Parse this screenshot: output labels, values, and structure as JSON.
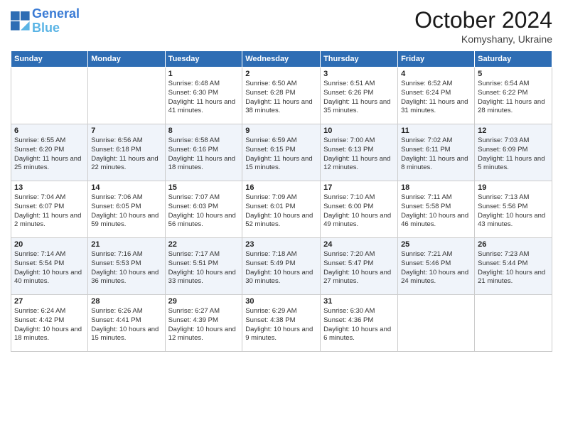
{
  "logo": {
    "line1": "General",
    "line2": "Blue"
  },
  "header": {
    "month": "October 2024",
    "location": "Komyshany, Ukraine"
  },
  "weekdays": [
    "Sunday",
    "Monday",
    "Tuesday",
    "Wednesday",
    "Thursday",
    "Friday",
    "Saturday"
  ],
  "weeks": [
    [
      {
        "day": "",
        "sunrise": "",
        "sunset": "",
        "daylight": ""
      },
      {
        "day": "",
        "sunrise": "",
        "sunset": "",
        "daylight": ""
      },
      {
        "day": "1",
        "sunrise": "Sunrise: 6:48 AM",
        "sunset": "Sunset: 6:30 PM",
        "daylight": "Daylight: 11 hours and 41 minutes."
      },
      {
        "day": "2",
        "sunrise": "Sunrise: 6:50 AM",
        "sunset": "Sunset: 6:28 PM",
        "daylight": "Daylight: 11 hours and 38 minutes."
      },
      {
        "day": "3",
        "sunrise": "Sunrise: 6:51 AM",
        "sunset": "Sunset: 6:26 PM",
        "daylight": "Daylight: 11 hours and 35 minutes."
      },
      {
        "day": "4",
        "sunrise": "Sunrise: 6:52 AM",
        "sunset": "Sunset: 6:24 PM",
        "daylight": "Daylight: 11 hours and 31 minutes."
      },
      {
        "day": "5",
        "sunrise": "Sunrise: 6:54 AM",
        "sunset": "Sunset: 6:22 PM",
        "daylight": "Daylight: 11 hours and 28 minutes."
      }
    ],
    [
      {
        "day": "6",
        "sunrise": "Sunrise: 6:55 AM",
        "sunset": "Sunset: 6:20 PM",
        "daylight": "Daylight: 11 hours and 25 minutes."
      },
      {
        "day": "7",
        "sunrise": "Sunrise: 6:56 AM",
        "sunset": "Sunset: 6:18 PM",
        "daylight": "Daylight: 11 hours and 22 minutes."
      },
      {
        "day": "8",
        "sunrise": "Sunrise: 6:58 AM",
        "sunset": "Sunset: 6:16 PM",
        "daylight": "Daylight: 11 hours and 18 minutes."
      },
      {
        "day": "9",
        "sunrise": "Sunrise: 6:59 AM",
        "sunset": "Sunset: 6:15 PM",
        "daylight": "Daylight: 11 hours and 15 minutes."
      },
      {
        "day": "10",
        "sunrise": "Sunrise: 7:00 AM",
        "sunset": "Sunset: 6:13 PM",
        "daylight": "Daylight: 11 hours and 12 minutes."
      },
      {
        "day": "11",
        "sunrise": "Sunrise: 7:02 AM",
        "sunset": "Sunset: 6:11 PM",
        "daylight": "Daylight: 11 hours and 8 minutes."
      },
      {
        "day": "12",
        "sunrise": "Sunrise: 7:03 AM",
        "sunset": "Sunset: 6:09 PM",
        "daylight": "Daylight: 11 hours and 5 minutes."
      }
    ],
    [
      {
        "day": "13",
        "sunrise": "Sunrise: 7:04 AM",
        "sunset": "Sunset: 6:07 PM",
        "daylight": "Daylight: 11 hours and 2 minutes."
      },
      {
        "day": "14",
        "sunrise": "Sunrise: 7:06 AM",
        "sunset": "Sunset: 6:05 PM",
        "daylight": "Daylight: 10 hours and 59 minutes."
      },
      {
        "day": "15",
        "sunrise": "Sunrise: 7:07 AM",
        "sunset": "Sunset: 6:03 PM",
        "daylight": "Daylight: 10 hours and 56 minutes."
      },
      {
        "day": "16",
        "sunrise": "Sunrise: 7:09 AM",
        "sunset": "Sunset: 6:01 PM",
        "daylight": "Daylight: 10 hours and 52 minutes."
      },
      {
        "day": "17",
        "sunrise": "Sunrise: 7:10 AM",
        "sunset": "Sunset: 6:00 PM",
        "daylight": "Daylight: 10 hours and 49 minutes."
      },
      {
        "day": "18",
        "sunrise": "Sunrise: 7:11 AM",
        "sunset": "Sunset: 5:58 PM",
        "daylight": "Daylight: 10 hours and 46 minutes."
      },
      {
        "day": "19",
        "sunrise": "Sunrise: 7:13 AM",
        "sunset": "Sunset: 5:56 PM",
        "daylight": "Daylight: 10 hours and 43 minutes."
      }
    ],
    [
      {
        "day": "20",
        "sunrise": "Sunrise: 7:14 AM",
        "sunset": "Sunset: 5:54 PM",
        "daylight": "Daylight: 10 hours and 40 minutes."
      },
      {
        "day": "21",
        "sunrise": "Sunrise: 7:16 AM",
        "sunset": "Sunset: 5:53 PM",
        "daylight": "Daylight: 10 hours and 36 minutes."
      },
      {
        "day": "22",
        "sunrise": "Sunrise: 7:17 AM",
        "sunset": "Sunset: 5:51 PM",
        "daylight": "Daylight: 10 hours and 33 minutes."
      },
      {
        "day": "23",
        "sunrise": "Sunrise: 7:18 AM",
        "sunset": "Sunset: 5:49 PM",
        "daylight": "Daylight: 10 hours and 30 minutes."
      },
      {
        "day": "24",
        "sunrise": "Sunrise: 7:20 AM",
        "sunset": "Sunset: 5:47 PM",
        "daylight": "Daylight: 10 hours and 27 minutes."
      },
      {
        "day": "25",
        "sunrise": "Sunrise: 7:21 AM",
        "sunset": "Sunset: 5:46 PM",
        "daylight": "Daylight: 10 hours and 24 minutes."
      },
      {
        "day": "26",
        "sunrise": "Sunrise: 7:23 AM",
        "sunset": "Sunset: 5:44 PM",
        "daylight": "Daylight: 10 hours and 21 minutes."
      }
    ],
    [
      {
        "day": "27",
        "sunrise": "Sunrise: 6:24 AM",
        "sunset": "Sunset: 4:42 PM",
        "daylight": "Daylight: 10 hours and 18 minutes."
      },
      {
        "day": "28",
        "sunrise": "Sunrise: 6:26 AM",
        "sunset": "Sunset: 4:41 PM",
        "daylight": "Daylight: 10 hours and 15 minutes."
      },
      {
        "day": "29",
        "sunrise": "Sunrise: 6:27 AM",
        "sunset": "Sunset: 4:39 PM",
        "daylight": "Daylight: 10 hours and 12 minutes."
      },
      {
        "day": "30",
        "sunrise": "Sunrise: 6:29 AM",
        "sunset": "Sunset: 4:38 PM",
        "daylight": "Daylight: 10 hours and 9 minutes."
      },
      {
        "day": "31",
        "sunrise": "Sunrise: 6:30 AM",
        "sunset": "Sunset: 4:36 PM",
        "daylight": "Daylight: 10 hours and 6 minutes."
      },
      {
        "day": "",
        "sunrise": "",
        "sunset": "",
        "daylight": ""
      },
      {
        "day": "",
        "sunrise": "",
        "sunset": "",
        "daylight": ""
      }
    ]
  ]
}
